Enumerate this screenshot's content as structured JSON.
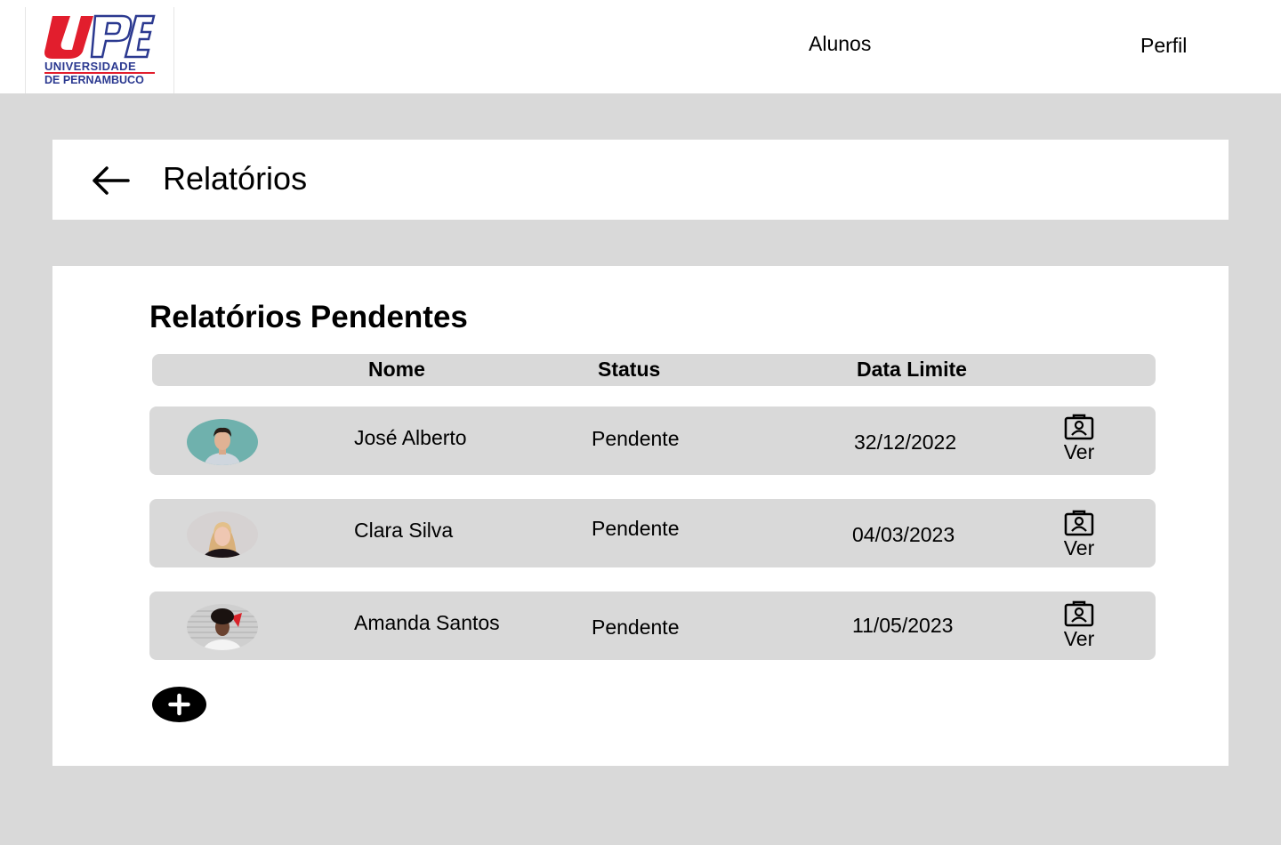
{
  "header": {
    "logo": {
      "mark": "UPE",
      "line1": "UNIVERSIDADE",
      "line2": "DE PERNAMBUCO",
      "brand_red": "#e21e2d",
      "brand_blue": "#2b3990"
    },
    "nav": {
      "alunos": "Alunos",
      "perfil": "Perfil"
    }
  },
  "page": {
    "title": "Relatórios",
    "back_icon": "arrow-left-icon"
  },
  "section": {
    "title": "Relatórios Pendentes",
    "columns": {
      "avatar": "",
      "nome": "Nome",
      "status": "Status",
      "data_limite": "Data Limite",
      "acao": ""
    },
    "rows": [
      {
        "nome": "José Alberto",
        "status": "Pendente",
        "data_limite": "32/12/2022",
        "action": "Ver",
        "action_icon": "report-card-icon",
        "avatar_bg": "#6fb1ad"
      },
      {
        "nome": "Clara Silva",
        "status": "Pendente",
        "data_limite": "04/03/2023",
        "action": "Ver",
        "action_icon": "report-card-icon",
        "avatar_bg": "#d6d2d2"
      },
      {
        "nome": "Amanda Santos",
        "status": "Pendente",
        "data_limite": "11/05/2023",
        "action": "Ver",
        "action_icon": "report-card-icon",
        "avatar_bg": "#cfcfcf"
      }
    ],
    "add_icon": "plus-icon"
  },
  "colors": {
    "background": "#d9d9d9",
    "card": "#ffffff",
    "row": "#d9d9d9",
    "text": "#000000"
  }
}
